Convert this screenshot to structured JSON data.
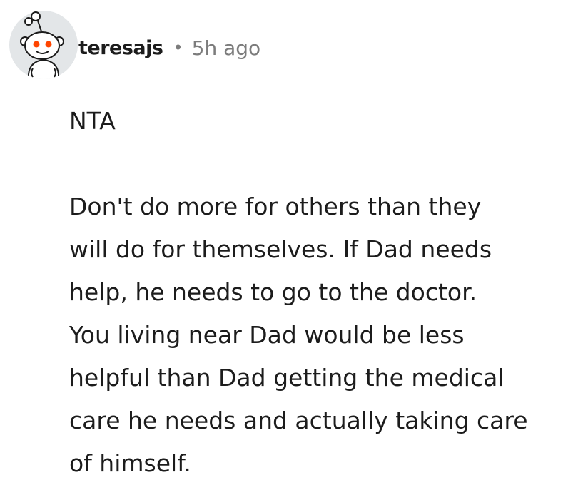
{
  "comment": {
    "author": "teresajs",
    "separator": "•",
    "timestamp": "5h ago",
    "avatar_icon": "reddit-snoo-avatar-icon",
    "paragraphs": [
      "NTA",
      "Don't do more for others than they\nwill do for themselves.  If Dad needs\nhelp, he needs to go to the doctor.\nYou living near Dad would be less\nhelpful than Dad getting the medical\ncare he needs and actually taking care\nof himself."
    ]
  },
  "colors": {
    "text": "#1c1c1c",
    "meta": "#7c7c7c",
    "avatar_bg": "#e3e6e8",
    "snoo_eye": "#ff4500"
  }
}
